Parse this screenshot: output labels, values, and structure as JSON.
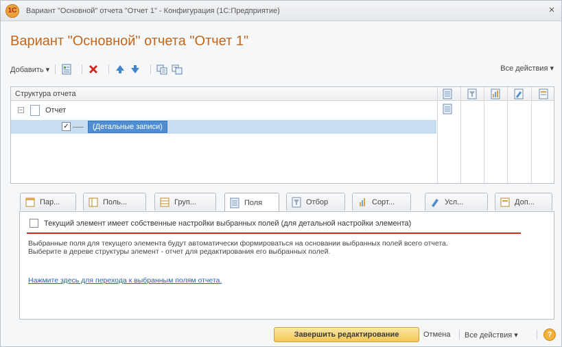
{
  "window": {
    "title": "Вариант \"Основной\" отчета \"Отчет 1\" - Конфигурация (1С:Предприятие)",
    "close_glyph": "×"
  },
  "form": {
    "title": "Вариант \"Основной\" отчета \"Отчет 1\""
  },
  "toolbar": {
    "add_label": "Добавить ▾",
    "all_actions_label": "Все действия ▾"
  },
  "tree": {
    "header_label": "Структура отчета",
    "root_label": "Отчет",
    "root_expander": "−",
    "child_label": "(Детальные записи)",
    "child_checkbox": "✓"
  },
  "tabs": [
    {
      "label": "Пар..."
    },
    {
      "label": "Поль..."
    },
    {
      "label": "Груп..."
    },
    {
      "label": "Поля"
    },
    {
      "label": "Отбор"
    },
    {
      "label": "Сорт..."
    },
    {
      "label": "Усл..."
    },
    {
      "label": "Доп..."
    }
  ],
  "fields_tab": {
    "checkbox_label": "Текущий элемент имеет собственные настройки выбранных полей (для детальной настройки элемента)",
    "info_line1": "Выбранные поля для текущего элемента будут автоматически формироваться на основании выбранных полей всего отчета.",
    "info_line2": "Выберите в дереве структуры элемент - отчет для редактирования его выбранных полей.",
    "link_text": "Нажмите здесь для перехода к выбранным полям отчета."
  },
  "bottom": {
    "finish_label": "Завершить редактирование",
    "cancel_label": "Отмена",
    "all_actions_label": "Все действия ▾",
    "help_glyph": "?"
  },
  "colors": {
    "title_orange": "#c2661b",
    "selection_blue": "#4f8ed2",
    "link_blue": "#2462b5",
    "underline_red": "#d4281c",
    "finish_button_yellow": "#f3c755"
  }
}
